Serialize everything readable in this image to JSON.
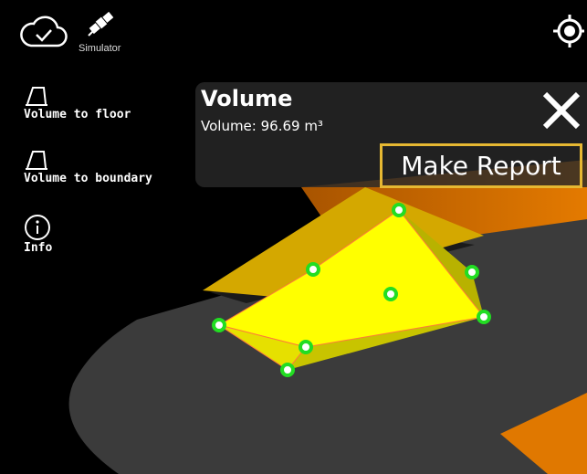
{
  "header": {
    "cloud_icon": "cloud-check-icon",
    "satellite_icon": "satellite-icon",
    "simulator_label": "Simulator",
    "locate_icon": "target-locate-icon"
  },
  "sidebar": {
    "items": [
      {
        "icon": "volume-floor-icon",
        "label": "Volume to floor"
      },
      {
        "icon": "volume-boundary-icon",
        "label": "Volume to boundary"
      },
      {
        "icon": "info-icon",
        "label": "Info"
      }
    ]
  },
  "volume_panel": {
    "title": "Volume",
    "value": "Volume: 96.69 m³",
    "make_report_label": "Make Report",
    "close_icon": "close-icon"
  },
  "colors": {
    "panel_bg": "#282828",
    "accent_border": "#e6b832",
    "volume_fill": "#ffff00",
    "marker": "#22dd22",
    "terrain_orange": "#e07800",
    "surface_gray": "#3a3a3a"
  }
}
